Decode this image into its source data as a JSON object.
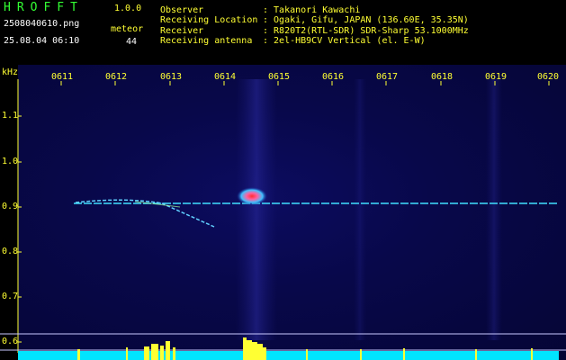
{
  "app": {
    "title": "HROFFT",
    "version": "1.0.0"
  },
  "file": {
    "name": "2508040610.png",
    "datetime": "25.08.04 06:10"
  },
  "counter": {
    "label": "meteor",
    "value": "44"
  },
  "info": [
    {
      "label": "Observer",
      "value": ": Takanori Kawachi"
    },
    {
      "label": "Receiving Location",
      "value": ": Ogaki, Gifu, JAPAN (136.60E, 35.35N)"
    },
    {
      "label": "Receiver",
      "value": ": R820T2(RTL-SDR) SDR-Sharp 53.1000MHz"
    },
    {
      "label": "Receiving antenna",
      "value": ": 2el-HB9CV Vertical (el. E-W)"
    }
  ],
  "axis": {
    "y_unit": "kHz",
    "x_ticks": [
      "0611",
      "0612",
      "0613",
      "0614",
      "0615",
      "0616",
      "0617",
      "0618",
      "0619",
      "0620"
    ],
    "y_ticks": [
      "1.1",
      "1.0",
      "0.9",
      "0.8",
      "0.7",
      "0.6"
    ]
  },
  "colors": {
    "label": "#ffff33",
    "title": "#33ff33",
    "bg": "#07073f",
    "signal": "#40e0ff",
    "meter": "#00e5ff"
  }
}
